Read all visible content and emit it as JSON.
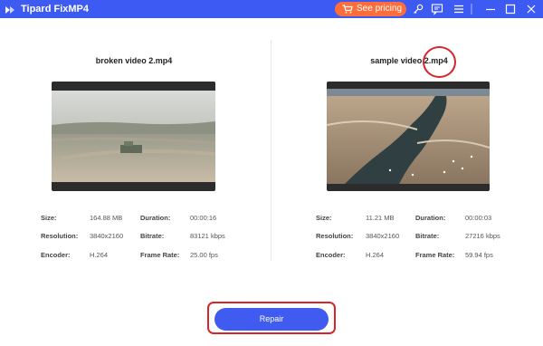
{
  "app": {
    "title": "Tipard FixMP4"
  },
  "titlebar": {
    "pricing_label": "See pricing",
    "icons": [
      "cart-icon",
      "key-icon",
      "chat-icon",
      "menu-icon",
      "minimize-icon",
      "maximize-icon",
      "close-icon"
    ]
  },
  "left": {
    "title": "broken video 2.mp4",
    "size_label": "Size:",
    "size": "164.88 MB",
    "duration_label": "Duration:",
    "duration": "00:00:16",
    "resolution_label": "Resolution:",
    "resolution": "3840x2160",
    "bitrate_label": "Bitrate:",
    "bitrate": "83121 kbps",
    "encoder_label": "Encoder:",
    "encoder": "H.264",
    "framerate_label": "Frame Rate:",
    "framerate": "25.00 fps"
  },
  "right": {
    "title": "sample video 2.mp4",
    "size_label": "Size:",
    "size": "11.21 MB",
    "duration_label": "Duration:",
    "duration": "00:00:03",
    "resolution_label": "Resolution:",
    "resolution": "3840x2160",
    "bitrate_label": "Bitrate:",
    "bitrate": "27216 kbps",
    "encoder_label": "Encoder:",
    "encoder": "H.264",
    "framerate_label": "Frame Rate:",
    "framerate": "59.94 fps"
  },
  "actions": {
    "repair_label": "Repair"
  },
  "colors": {
    "titlebar": "#3d5bf3",
    "pricing": "#ff6d3a",
    "repair": "#3f5bf0",
    "highlight": "#d6262c"
  }
}
